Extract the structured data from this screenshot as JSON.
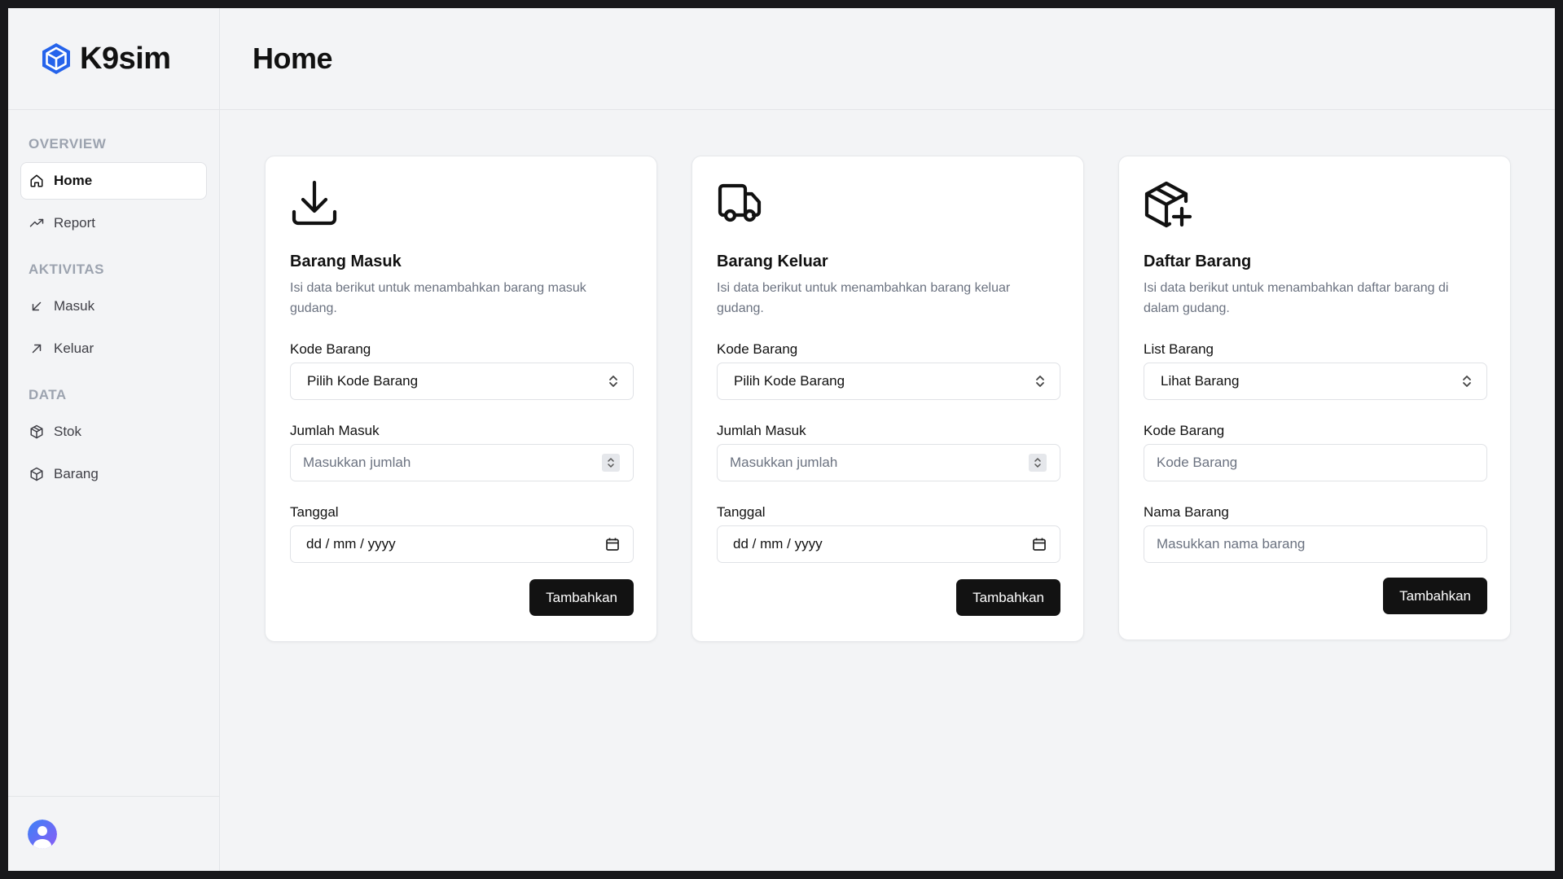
{
  "brand": {
    "name": "K9sim",
    "accent": "#2563eb"
  },
  "header": {
    "title": "Home"
  },
  "sidebar": {
    "sections": [
      {
        "label": "OVERVIEW",
        "items": [
          {
            "label": "Home",
            "icon": "home-icon",
            "active": true
          },
          {
            "label": "Report",
            "icon": "trending-up-icon"
          }
        ]
      },
      {
        "label": "AKTIVITAS",
        "items": [
          {
            "label": "Masuk",
            "icon": "arrow-down-left-icon"
          },
          {
            "label": "Keluar",
            "icon": "arrow-up-right-icon"
          }
        ]
      },
      {
        "label": "DATA",
        "items": [
          {
            "label": "Stok",
            "icon": "package-icon"
          },
          {
            "label": "Barang",
            "icon": "package-icon"
          }
        ]
      }
    ]
  },
  "cards": [
    {
      "icon": "download-icon",
      "title": "Barang Masuk",
      "description": "Isi data berikut untuk menambahkan barang masuk gudang.",
      "fields": [
        {
          "label": "Kode Barang",
          "type": "select",
          "value": "Pilih Kode Barang"
        },
        {
          "label": "Jumlah Masuk",
          "type": "number",
          "placeholder": "Masukkan jumlah"
        },
        {
          "label": "Tanggal",
          "type": "date",
          "value": "dd / mm / yyyy"
        }
      ],
      "button": "Tambahkan"
    },
    {
      "icon": "truck-icon",
      "title": "Barang Keluar",
      "description": "Isi data berikut untuk menambahkan barang keluar gudang.",
      "fields": [
        {
          "label": "Kode Barang",
          "type": "select",
          "value": "Pilih Kode Barang"
        },
        {
          "label": "Jumlah Masuk",
          "type": "number",
          "placeholder": "Masukkan jumlah"
        },
        {
          "label": "Tanggal",
          "type": "date",
          "value": "dd / mm / yyyy"
        }
      ],
      "button": "Tambahkan"
    },
    {
      "icon": "package-plus-icon",
      "title": "Daftar Barang",
      "description": "Isi data berikut untuk menambahkan daftar barang di dalam gudang.",
      "fields": [
        {
          "label": "List Barang",
          "type": "select",
          "value": "Lihat Barang"
        },
        {
          "label": "Kode Barang",
          "type": "text",
          "placeholder": "Kode Barang"
        },
        {
          "label": "Nama Barang",
          "type": "text",
          "placeholder": "Masukkan nama barang"
        }
      ],
      "button": "Tambahkan"
    }
  ],
  "user": {
    "avatar_color": "#6366f1"
  }
}
